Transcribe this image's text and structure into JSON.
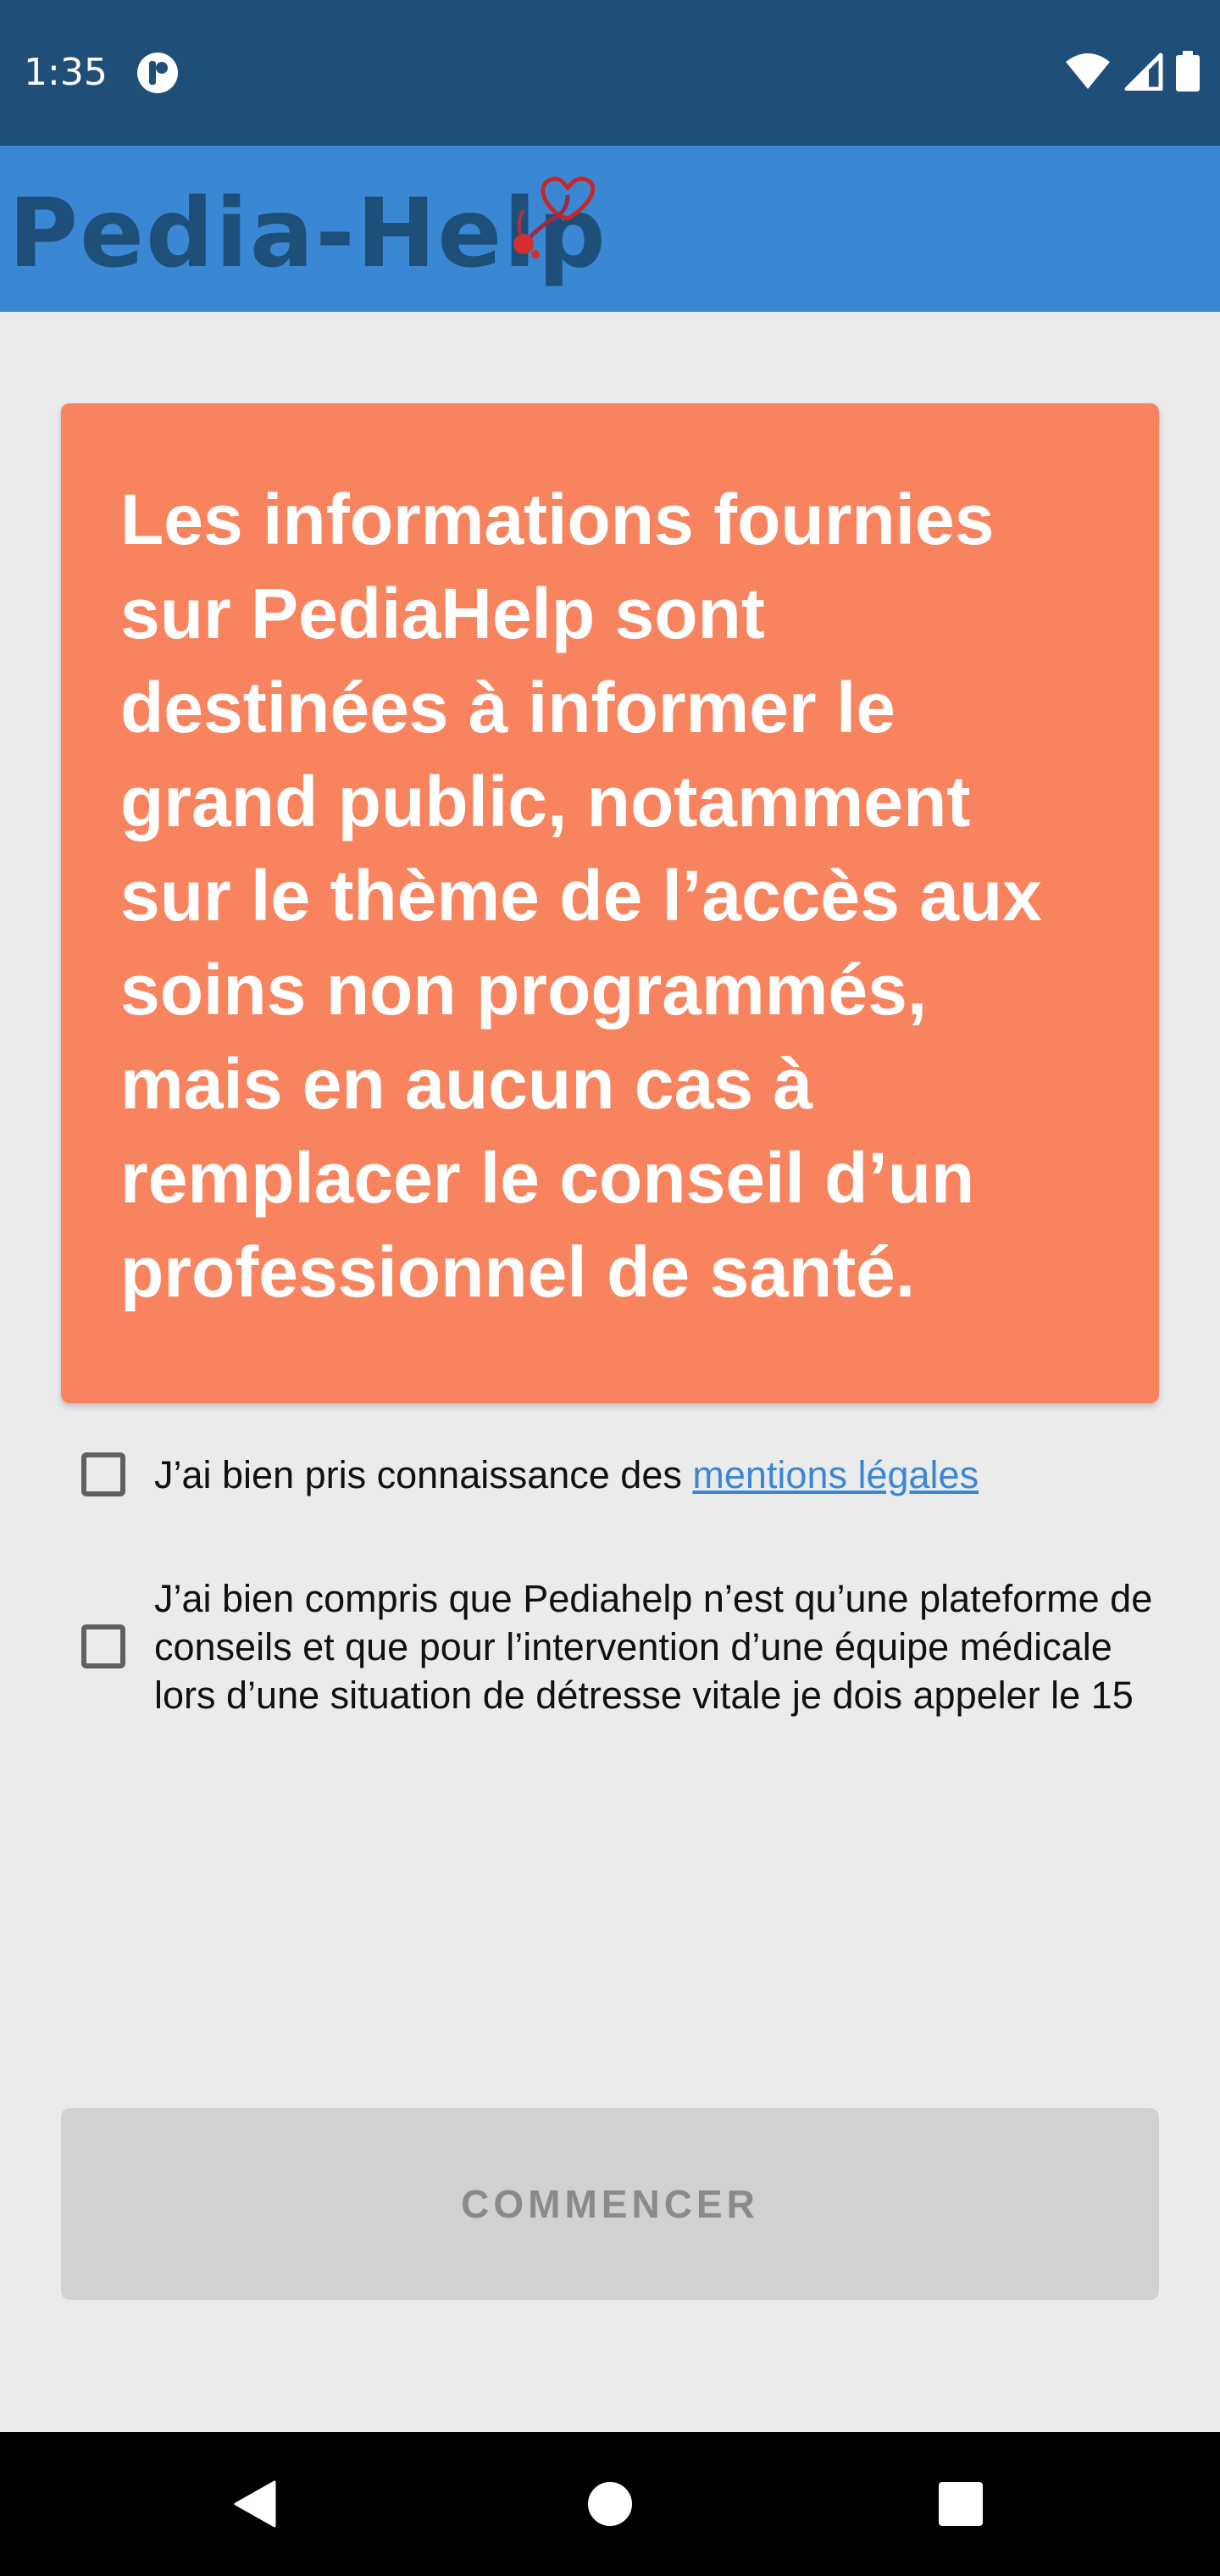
{
  "status_bar": {
    "time": "1:35",
    "app_icon": "pediahelp-notification-icon",
    "wifi_icon": "wifi-icon",
    "signal_icon": "signal-icon",
    "battery_icon": "battery-icon"
  },
  "app_bar": {
    "logo_text": "Pedia-Help",
    "logo_icon": "heart-stethoscope-icon"
  },
  "warning": {
    "text": "Les informations fournies sur PediaHelp sont destinées à informer le grand public, notamment sur le thème de l’accès aux soins non programmés, mais en aucun cas à remplacer le conseil d’un professionnel de santé."
  },
  "agreements": {
    "legal_prefix": "J’ai bien pris connaissance des ",
    "legal_link": "mentions légales",
    "legal_checked": false,
    "emergency_text": "J’ai bien compris que Pediahelp n’est qu’une plateforme de conseils et que pour l’intervention d’une équipe médicale lors d’une situation de détresse vitale je dois appeler le 15",
    "emergency_checked": false
  },
  "start_button": {
    "label": "COMMENCER",
    "enabled": false
  },
  "nav_bar": {
    "back_icon": "back-icon",
    "home_icon": "home-icon",
    "recents_icon": "recents-icon"
  },
  "colors": {
    "status_bar": "#1f4e79",
    "app_bar": "#3a88d4",
    "warning_card": "#f7845e",
    "link": "#3a88d4",
    "disabled_button": "#d1d1d1",
    "background": "#ebebeb"
  }
}
